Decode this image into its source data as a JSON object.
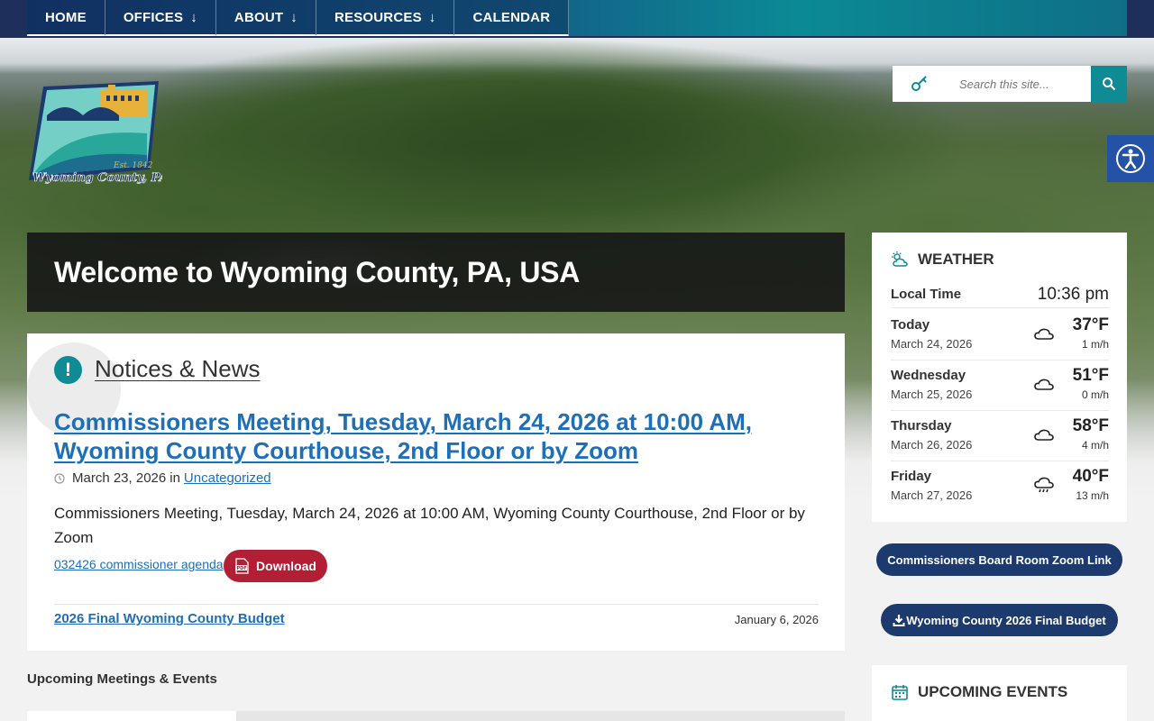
{
  "nav": {
    "items": [
      {
        "label": "HOME",
        "has_dropdown": false
      },
      {
        "label": "OFFICES",
        "has_dropdown": true
      },
      {
        "label": "ABOUT",
        "has_dropdown": true
      },
      {
        "label": "RESOURCES",
        "has_dropdown": true
      },
      {
        "label": "CALENDAR",
        "has_dropdown": false
      }
    ],
    "arrow_glyph": "↓"
  },
  "logo": {
    "established": "Est. 1842",
    "name": "Wyoming County, PA"
  },
  "search": {
    "placeholder": "Search this site..."
  },
  "welcome": {
    "title": "Welcome to Wyoming County, PA, USA"
  },
  "news": {
    "section_title": "Notices & News",
    "headline": "Commissioners Meeting, Tuesday, March 24, 2026 at 10:00 AM, Wyoming County Courthouse, 2nd Floor or by Zoom",
    "date": "March 23, 2026",
    "in_text": "in",
    "category": "Uncategorized",
    "excerpt": "Commissioners Meeting, Tuesday, March 24, 2026 at 10:00 AM, Wyoming County Courthouse, 2nd Floor or by Zoom",
    "attachment": "032426 commissioner agenda",
    "download_label": "Download",
    "second_link": "2026 Final Wyoming County Budget",
    "second_date": "January 6, 2026"
  },
  "upcoming_label": "Upcoming Meetings & Events",
  "weather": {
    "title": "WEATHER",
    "local_time_label": "Local Time",
    "local_time": "10:36 pm",
    "days": [
      {
        "day": "Today",
        "date": "March 24, 2026",
        "temp": "37°F",
        "wind": "1 m/h",
        "icon": "cloud-icon"
      },
      {
        "day": "Wednesday",
        "date": "March 25, 2026",
        "temp": "51°F",
        "wind": "0 m/h",
        "icon": "cloud-icon"
      },
      {
        "day": "Thursday",
        "date": "March 26, 2026",
        "temp": "58°F",
        "wind": "4 m/h",
        "icon": "cloud-icon"
      },
      {
        "day": "Friday",
        "date": "March 27, 2026",
        "temp": "40°F",
        "wind": "13 m/h",
        "icon": "rain-cloud-icon"
      }
    ]
  },
  "buttons": {
    "zoom_link": "Commissioners Board Room Zoom Link",
    "final_budget": "Wyoming County 2026 Final Budget"
  },
  "events": {
    "title": "UPCOMING EVENTS"
  },
  "colors": {
    "accent_teal": "#0e8b95",
    "link_blue": "#1e6fb7",
    "download_red": "#b21f35",
    "navy_pill": "#1d3a6e"
  }
}
